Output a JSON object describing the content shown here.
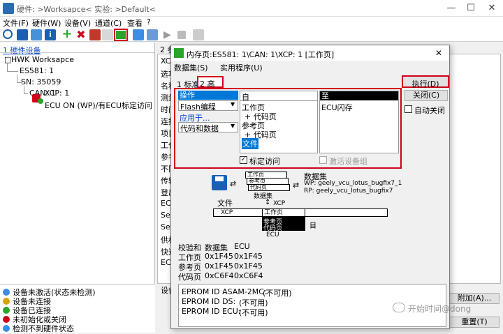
{
  "window": {
    "title": "硬件: >Worksapce<  实验: >Default<",
    "min": "—",
    "max": "☐",
    "close": "✕"
  },
  "menu": [
    "文件(F)",
    "硬件(W)",
    "设备(V)",
    "通道(C)",
    "查看",
    "?"
  ],
  "left_pane": {
    "title": "1 硬件设备",
    "tree": [
      "HWK Worksapce",
      "ES581: 1",
      "SN: 35059",
      "CAN: 1",
      "XCP: 1",
      "ECU ON (WP)/有ECU标定访问"
    ]
  },
  "status_legend": [
    {
      "label": "设备未激活(状态未检测)",
      "color": "#3a8ee6"
    },
    {
      "label": "设备未连接",
      "color": "#d9a400"
    },
    {
      "label": "设备已连接",
      "color": "#2aa52a"
    },
    {
      "label": "未初始化或关闭",
      "color": "#d0021b"
    },
    {
      "label": "检测不到硬件状态",
      "color": "#3a8ee6"
    }
  ],
  "mid_pane": {
    "tab": "2 参",
    "rows": [
      "XCP",
      "选项",
      "名称",
      "测量",
      "时间",
      "连接",
      "项目",
      "工作",
      "参考",
      "不同",
      "传输",
      "登出",
      "ECU",
      "See",
      "See",
      "供权",
      "快速",
      "ECU",
      "设备"
    ],
    "right_buttons": [
      "附加(A)...",
      "重置(T)"
    ]
  },
  "dialog": {
    "title": "内存页:ES581: 1\\CAN: 1\\XCP: 1 [工作页]",
    "close": "✕",
    "menu": [
      "数据集(S)",
      "实用程序(U)"
    ],
    "tabs": [
      "1 标准",
      "2 高级"
    ],
    "op_header": "操作",
    "op_flash": "Flash编程",
    "op_apply": "应用于...",
    "op_code": "代码和数据",
    "from_header": "自",
    "from_items": [
      "工作页",
      "+ 代码页",
      "参考页",
      "+ 代码页",
      "文件"
    ],
    "to_header": "至",
    "to_items": [
      "ECU闪存"
    ],
    "calib_access": "标定访问",
    "activate_group": "激活设备组",
    "buttons": {
      "execute": "执行(D)",
      "close": "关闭(C)",
      "auto_close": "自动关闭"
    },
    "diagram": {
      "dataset_label": "数据集",
      "wp": "WP: geely_vcu_lotus_bugfix7_1",
      "rp": "RP: geely_vcu_lotus_bugfix7",
      "file_label": "文件",
      "stack_top": [
        "工作页",
        "参考页",
        "代码页",
        "数据集"
      ],
      "xcp_small": "XCP",
      "xcp": "XCP",
      "ecu_pages": [
        "工作页",
        "参考页",
        "代码页"
      ],
      "ecu": "ECU",
      "side_mark": "目"
    },
    "checksum": {
      "headers": [
        "校验和",
        "数据集",
        "ECU"
      ],
      "rows": [
        [
          "工作页",
          "0x1F45",
          "0x1F45"
        ],
        [
          "参考页",
          "0x1F45",
          "0x1F45"
        ],
        [
          "代码页",
          "0xC6F4",
          "0xC6F4"
        ]
      ]
    },
    "eprom": [
      {
        "label": "EPROM ID ASAM-2MC:",
        "value": "(不可用)"
      },
      {
        "label": "EPROM ID DS:",
        "value": "(不可用)"
      },
      {
        "label": "EPROM ID ECU:",
        "value": "(不可用)"
      }
    ]
  },
  "watermark": "开始时间@dong"
}
